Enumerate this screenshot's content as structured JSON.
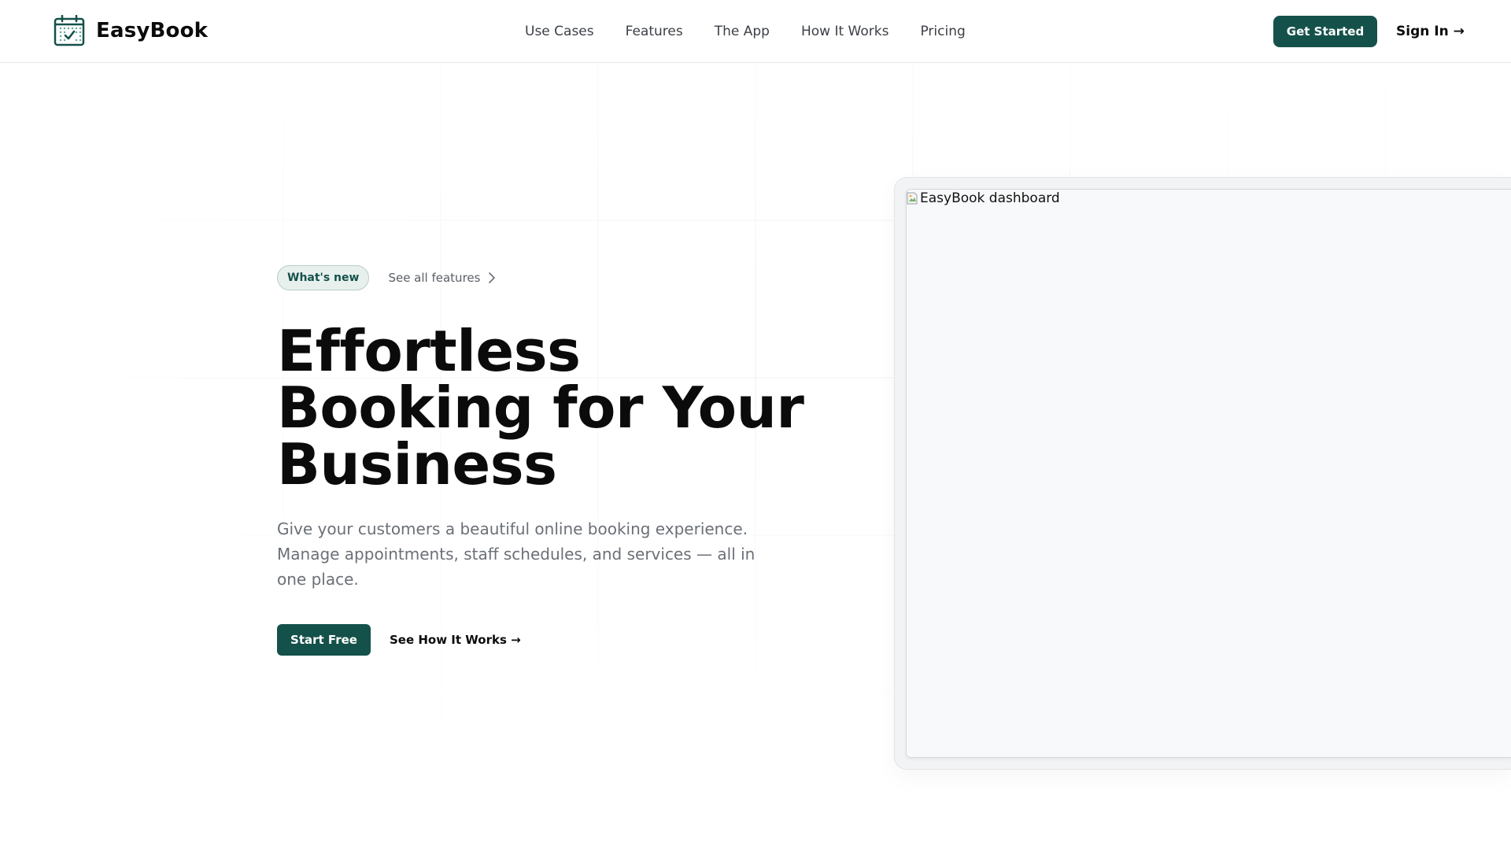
{
  "brand": {
    "name": "EasyBook",
    "accent": "#14514a"
  },
  "nav": {
    "items": [
      {
        "label": "Use Cases"
      },
      {
        "label": "Features"
      },
      {
        "label": "The App"
      },
      {
        "label": "How It Works"
      },
      {
        "label": "Pricing"
      }
    ],
    "get_started_label": "Get Started",
    "sign_in_label": "Sign In →"
  },
  "hero": {
    "badge": "What's new",
    "see_all": "See all features",
    "headline_lines": [
      "Effortless",
      "Booking for Your",
      "Business"
    ],
    "subtext": "Give your customers a beautiful online booking experience. Manage appointments, staff schedules, and services — all in one place.",
    "primary_cta": "Start Free",
    "secondary_cta": "See How It Works →"
  },
  "dashboard": {
    "image_alt": "EasyBook dashboard"
  },
  "icons": {
    "logo": "calendar-check-icon",
    "chevron": "chevron-right-icon",
    "broken_image": "broken-image-icon"
  }
}
